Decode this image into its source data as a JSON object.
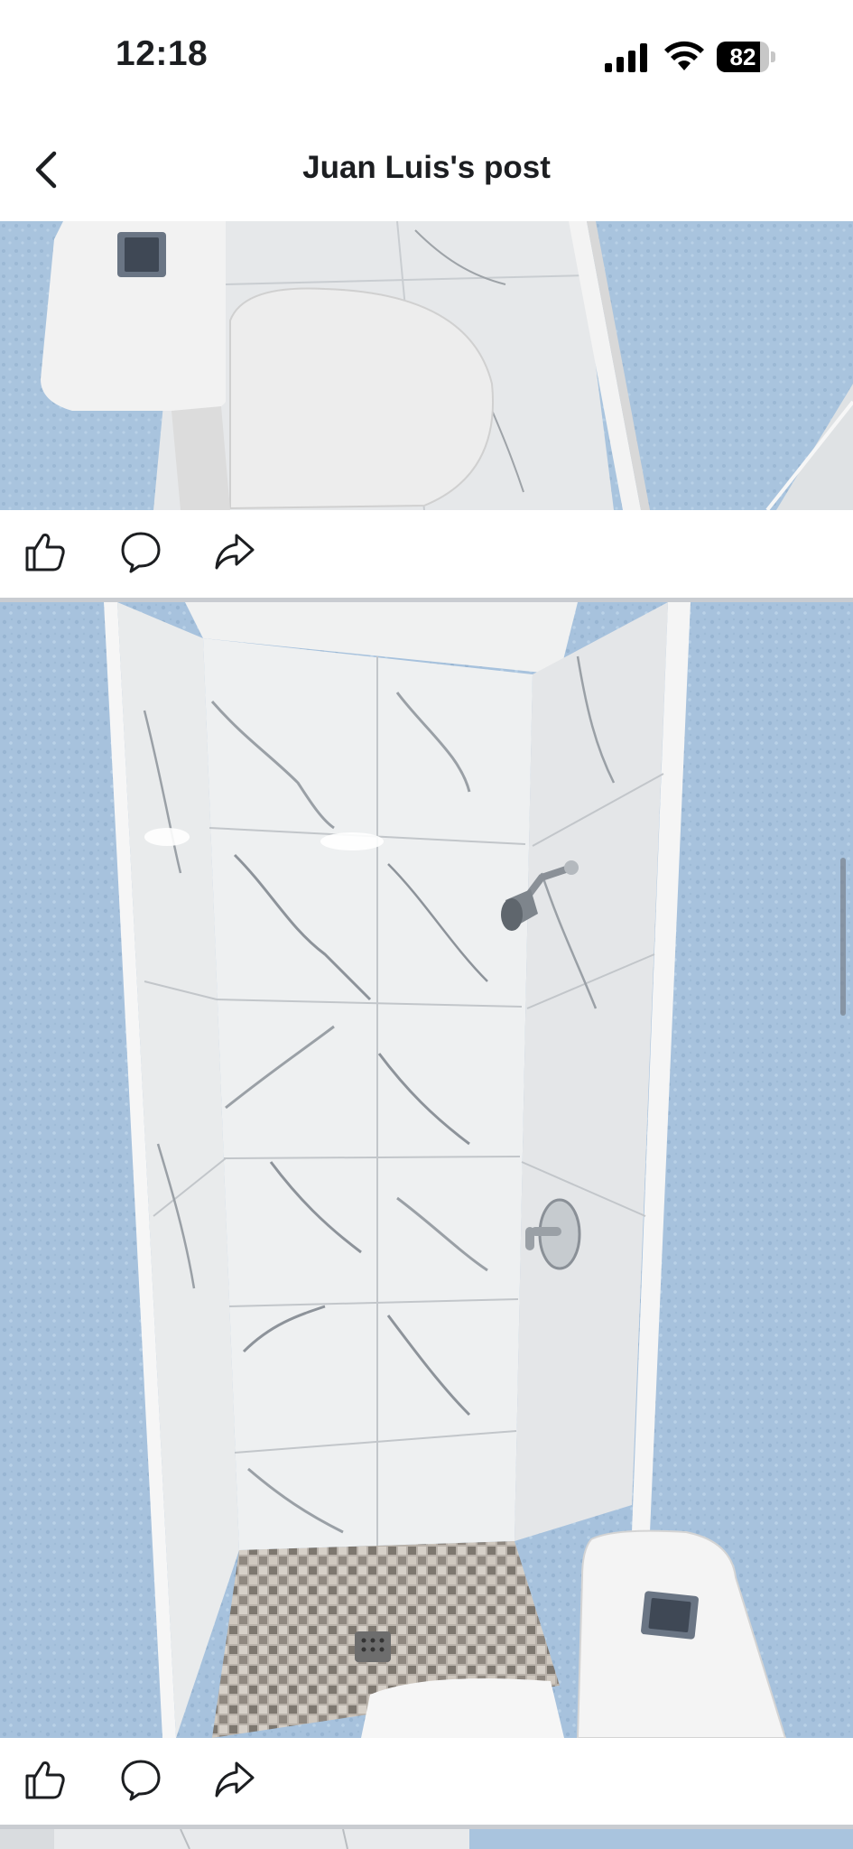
{
  "status_bar": {
    "time": "12:18",
    "battery_level": "82",
    "battery_fraction": 0.82
  },
  "header": {
    "title": "Juan Luis's post",
    "back_icon": "chevron-left-icon"
  },
  "posts": [
    {
      "image_subject": "bathroom-toilet-marble-tile",
      "actions": [
        {
          "icon": "like-icon"
        },
        {
          "icon": "comment-icon"
        },
        {
          "icon": "share-icon"
        }
      ]
    },
    {
      "image_subject": "tiled-shower-stall",
      "actions": [
        {
          "icon": "like-icon"
        },
        {
          "icon": "comment-icon"
        },
        {
          "icon": "share-icon"
        }
      ]
    }
  ],
  "colors": {
    "wall_blue": "#a7c3df",
    "marble_white": "#eceeee",
    "chrome": "#9aa0a6",
    "divider": "#c9ccd1",
    "text": "#1c1e21"
  }
}
